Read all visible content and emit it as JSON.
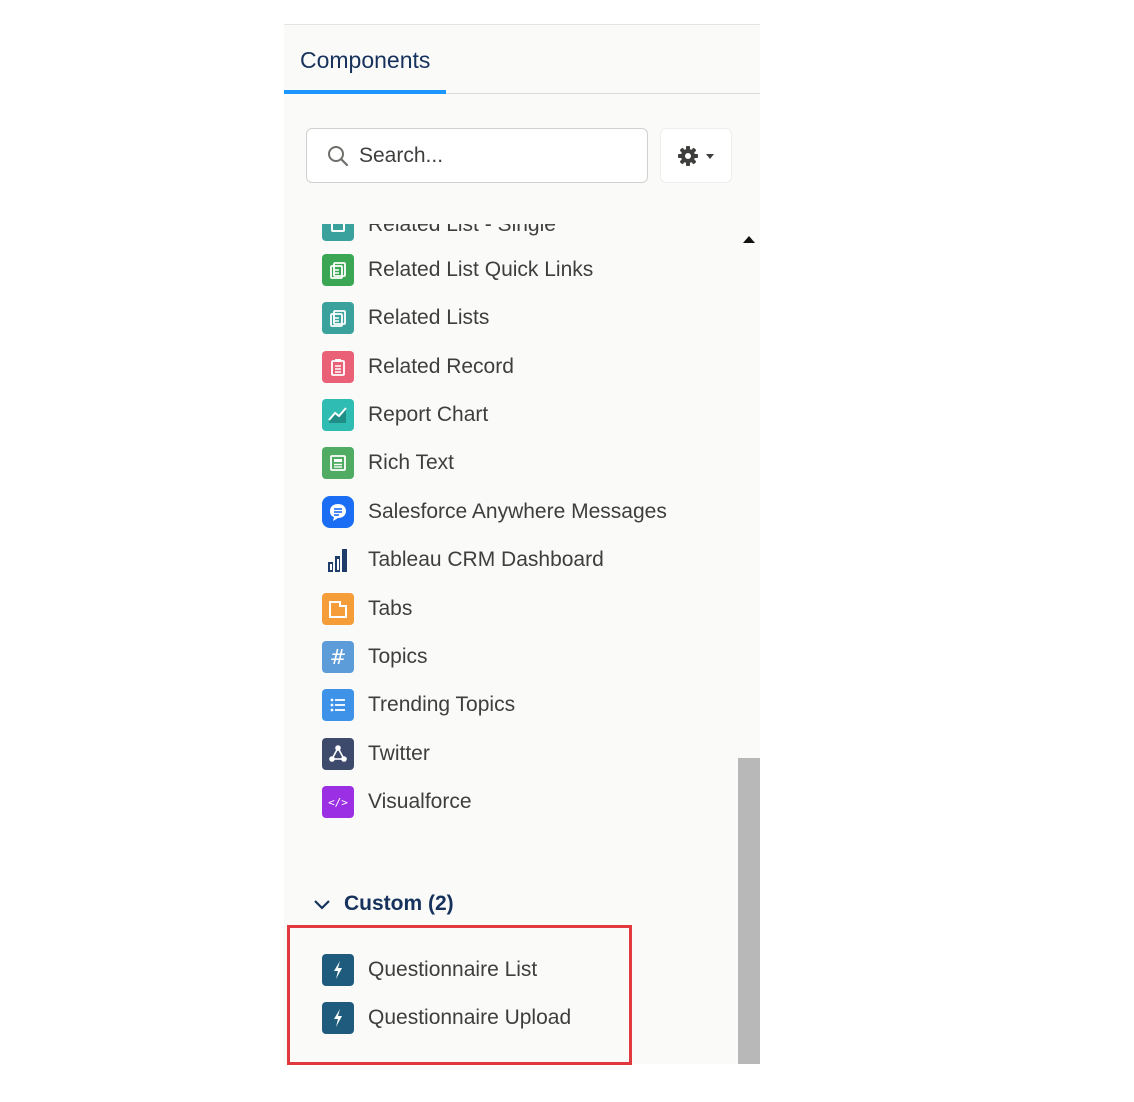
{
  "tab": {
    "label": "Components"
  },
  "search": {
    "placeholder": "Search..."
  },
  "partial_item": {
    "label": "Related List - Single"
  },
  "items": [
    {
      "label": "Related List Quick Links",
      "icon": "related-list-icon",
      "color": "#3ba755"
    },
    {
      "label": "Related Lists",
      "icon": "related-list-icon",
      "color": "#3ba19c"
    },
    {
      "label": "Related Record",
      "icon": "clipboard-icon",
      "color": "#ea6077"
    },
    {
      "label": "Report Chart",
      "icon": "line-chart-icon",
      "color": "#2fbdb3"
    },
    {
      "label": "Rich Text",
      "icon": "rich-text-icon",
      "color": "#4fac62"
    },
    {
      "label": "Salesforce Anywhere Messages",
      "icon": "chat-bubble-icon",
      "color": "#1b6ef3"
    },
    {
      "label": "Tableau CRM Dashboard",
      "icon": "bar-chart-icon",
      "color": "#1f3d6b"
    },
    {
      "label": "Tabs",
      "icon": "tabs-icon",
      "color": "#f59d38"
    },
    {
      "label": "Topics",
      "icon": "hashtag-icon",
      "color": "#5c9dd9"
    },
    {
      "label": "Trending Topics",
      "icon": "list-icon",
      "color": "#3e93e8"
    },
    {
      "label": "Twitter",
      "icon": "network-icon",
      "color": "#3d4a6b"
    },
    {
      "label": "Visualforce",
      "icon": "code-icon",
      "color": "#9b2fe3"
    }
  ],
  "custom": {
    "header": "Custom (2)",
    "items": [
      {
        "label": "Questionnaire List",
        "icon": "lightning-icon",
        "color": "#1f5b7d"
      },
      {
        "label": "Questionnaire Upload",
        "icon": "lightning-icon",
        "color": "#1f5b7d"
      }
    ]
  },
  "colors": {
    "highlight": "#e03a3e",
    "tab_underline": "#1b96ff"
  }
}
